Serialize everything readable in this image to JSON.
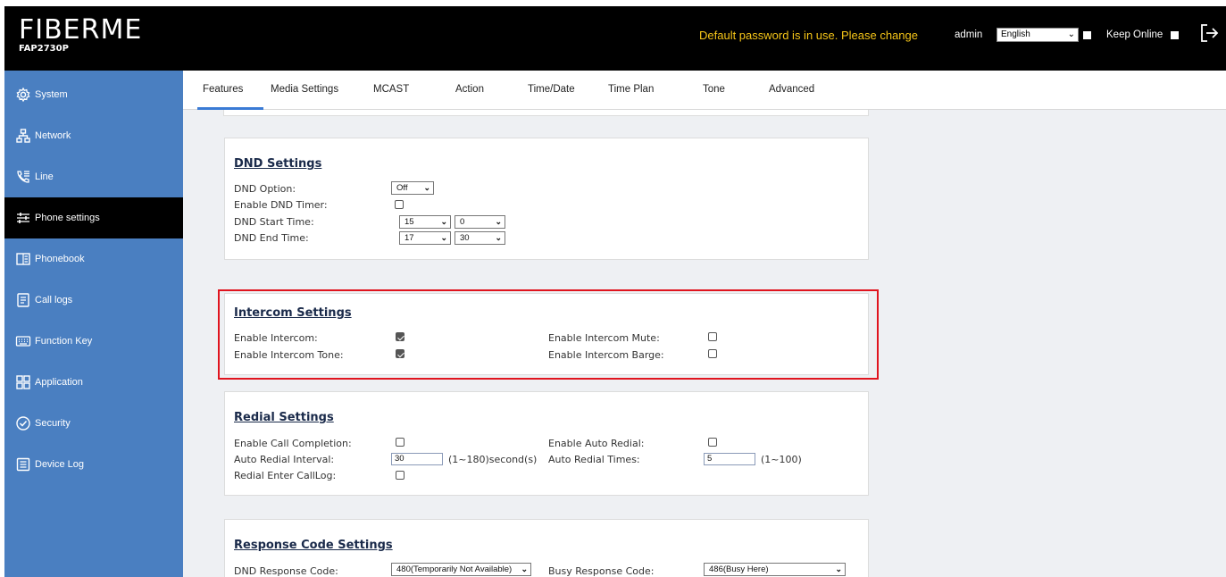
{
  "header": {
    "logo_text": "FIBERME",
    "model": "FAP2730P",
    "warning": "Default password is in use. Please change",
    "user": "admin",
    "language": "English",
    "keep_online": "Keep Online"
  },
  "sidebar": {
    "items": [
      {
        "label": "System",
        "icon": "gear-icon"
      },
      {
        "label": "Network",
        "icon": "network-icon"
      },
      {
        "label": "Line",
        "icon": "phone-line-icon"
      },
      {
        "label": "Phone settings",
        "icon": "sliders-icon",
        "active": true
      },
      {
        "label": "Phonebook",
        "icon": "book-icon"
      },
      {
        "label": "Call logs",
        "icon": "list-icon"
      },
      {
        "label": "Function Key",
        "icon": "keyboard-icon"
      },
      {
        "label": "Application",
        "icon": "grid-icon"
      },
      {
        "label": "Security",
        "icon": "shield-icon"
      },
      {
        "label": "Device Log",
        "icon": "log-icon"
      }
    ]
  },
  "tabs": [
    "Features",
    "Media Settings",
    "MCAST",
    "Action",
    "Time/Date",
    "Time Plan",
    "Tone",
    "Advanced"
  ],
  "dnd": {
    "title": "DND Settings",
    "option_label": "DND Option:",
    "option_value": "Off",
    "timer_label": "Enable DND Timer:",
    "timer_checked": false,
    "start_label": "DND Start Time:",
    "start_hour": "15",
    "start_min": "0",
    "end_label": "DND End Time:",
    "end_hour": "17",
    "end_min": "30"
  },
  "intercom": {
    "title": "Intercom Settings",
    "enable_label": "Enable Intercom:",
    "enable_checked": true,
    "mute_label": "Enable Intercom Mute:",
    "mute_checked": false,
    "tone_label": "Enable Intercom Tone:",
    "tone_checked": true,
    "barge_label": "Enable Intercom Barge:",
    "barge_checked": false
  },
  "redial": {
    "title": "Redial Settings",
    "completion_label": "Enable Call Completion:",
    "completion_checked": false,
    "auto_label": "Enable Auto Redial:",
    "auto_checked": false,
    "interval_label": "Auto Redial Interval:",
    "interval_value": "30",
    "interval_hint": "(1~180)second(s)",
    "times_label": "Auto Redial Times:",
    "times_value": "5",
    "times_hint": "(1~100)",
    "calllog_label": "Redial Enter CallLog:",
    "calllog_checked": false
  },
  "response": {
    "title": "Response Code Settings",
    "dnd_label": "DND Response Code:",
    "dnd_value": "480(Temporarily Not Available)",
    "busy_label": "Busy Response Code:",
    "busy_value": "486(Busy Here)"
  },
  "colors": {
    "sidebar": "#4a7fc1",
    "active": "#000000",
    "warning": "#f5c518",
    "highlight": "#e0141e",
    "tab_underline": "#3a7bd5"
  }
}
